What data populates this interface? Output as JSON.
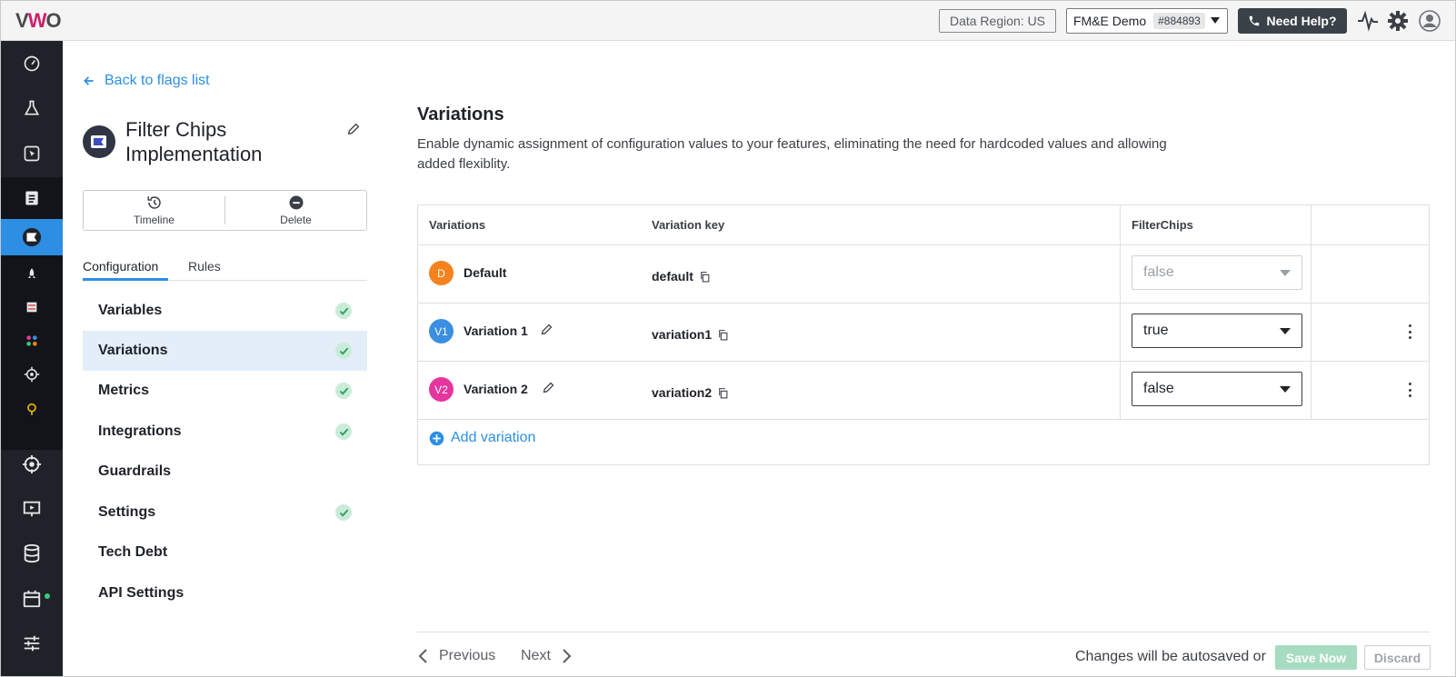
{
  "topbar": {
    "logo": {
      "v": "V",
      "w": "W",
      "o": "O"
    },
    "data_region": "Data Region: US",
    "account_name": "FM&E Demo",
    "account_id": "#884893",
    "help_label": "Need Help?"
  },
  "sidebar": {
    "icons": [
      "dashboard-icon",
      "flask-icon",
      "cursor-icon",
      "list-icon",
      "flag-icon",
      "rocket-icon",
      "server-icon",
      "apps-icon",
      "target-icon",
      "bulb-icon",
      "crosshair-icon",
      "presentation-icon",
      "database-icon",
      "calendar-icon",
      "sliders-icon"
    ],
    "active": "flag-icon"
  },
  "config": {
    "back_label": "Back to flags list",
    "flag_name": "Filter Chips Implementation",
    "actions": {
      "timeline": "Timeline",
      "delete": "Delete"
    },
    "tabs": {
      "configuration": "Configuration",
      "rules": "Rules"
    },
    "nav": [
      {
        "label": "Variables",
        "done": true
      },
      {
        "label": "Variations",
        "done": true
      },
      {
        "label": "Metrics",
        "done": true
      },
      {
        "label": "Integrations",
        "done": true
      },
      {
        "label": "Guardrails",
        "done": false
      },
      {
        "label": "Settings",
        "done": true
      },
      {
        "label": "Tech Debt",
        "done": false
      },
      {
        "label": "API Settings",
        "done": false
      }
    ],
    "active_nav": "Variations"
  },
  "main": {
    "title": "Variations",
    "description": "Enable dynamic assignment of configuration values to your features, eliminating the need for hardcoded values and allowing added flexiblity.",
    "columns": {
      "variations": "Variations",
      "key": "Variation key",
      "variable": "FilterChips"
    },
    "rows": [
      {
        "badge": "D",
        "badge_color": "#f5821f",
        "name": "Default",
        "key": "default",
        "value": "false",
        "editable": false
      },
      {
        "badge": "V1",
        "badge_color": "#3a8fe0",
        "name": "Variation 1",
        "key": "variation1",
        "value": "true",
        "editable": true
      },
      {
        "badge": "V2",
        "badge_color": "#e6359e",
        "name": "Variation 2",
        "key": "variation2",
        "value": "false",
        "editable": true
      }
    ],
    "add_variation": "Add variation"
  },
  "footer": {
    "previous": "Previous",
    "next": "Next",
    "autosave": "Changes will be autosaved or",
    "save": "Save Now",
    "discard": "Discard"
  },
  "colors": {
    "accent": "#2d8ee4",
    "sidebar": "#1f2329",
    "success": "#3bc77a"
  }
}
